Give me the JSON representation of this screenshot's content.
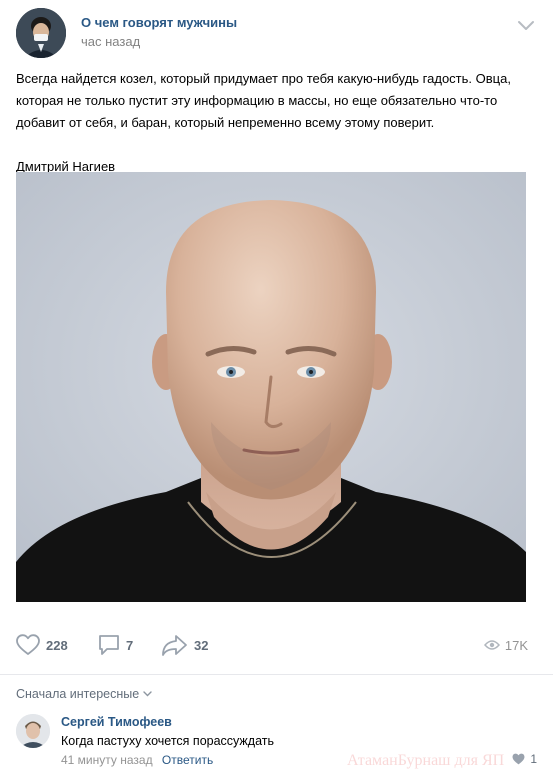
{
  "post": {
    "group_name": "О чем говорят мужчины",
    "time": "час назад",
    "text": "Всегда найдется козел, который придумает про тебя какую-нибудь гадость. Овца, которая не только пустит эту информацию в массы, но еще обязательно что-то добавит от себя, и баран, который непременно всему этому поверит.\n\nДмитрий Нагиев",
    "photo_icon": "portrait-photo"
  },
  "actions": {
    "likes": "228",
    "comments": "7",
    "shares": "32",
    "views": "17K"
  },
  "comments_section": {
    "sort_label": "Сначала интересные"
  },
  "comment": {
    "author": "Сергей Тимофеев",
    "text": "Когда пастуху хочется порассуждать",
    "time": "41 минуту назад",
    "reply_label": "Ответить",
    "likes": "1"
  },
  "watermark": "АтаманБурнаш для ЯП",
  "colors": {
    "link": "#2a5885",
    "meta": "#828282",
    "action": "#626d7a"
  }
}
